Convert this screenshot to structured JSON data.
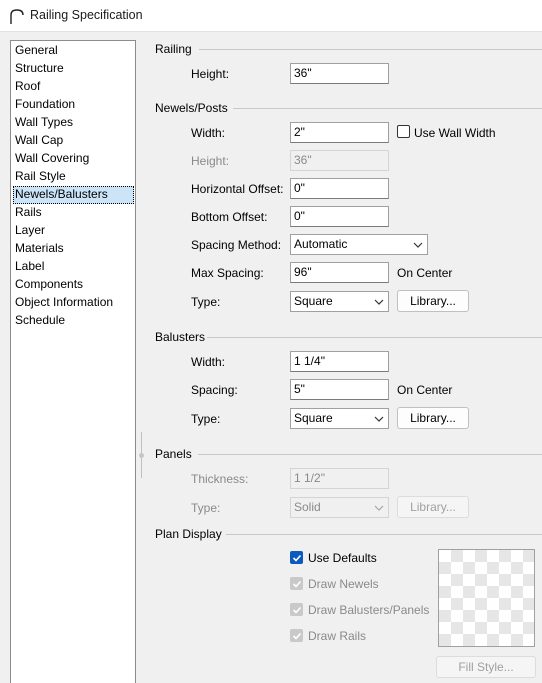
{
  "window": {
    "title": "Railing Specification"
  },
  "nav": {
    "items": [
      "General",
      "Structure",
      "Roof",
      "Foundation",
      "Wall Types",
      "Wall Cap",
      "Wall Covering",
      "Rail Style",
      "Newels/Balusters",
      "Rails",
      "Layer",
      "Materials",
      "Label",
      "Components",
      "Object Information",
      "Schedule"
    ],
    "selected": "Newels/Balusters"
  },
  "railing": {
    "title": "Railing",
    "height_label": "Height:",
    "height_value": "36\""
  },
  "newels": {
    "title": "Newels/Posts",
    "width_label": "Width:",
    "width_value": "2\"",
    "use_wall_width_label": "Use Wall Width",
    "use_wall_width_checked": false,
    "height_label": "Height:",
    "height_value": "36\"",
    "h_offset_label": "Horizontal Offset:",
    "h_offset_value": "0\"",
    "b_offset_label": "Bottom Offset:",
    "b_offset_value": "0\"",
    "spacing_method_label": "Spacing Method:",
    "spacing_method_value": "Automatic",
    "max_spacing_label": "Max Spacing:",
    "max_spacing_value": "96\"",
    "max_spacing_unit": "On Center",
    "type_label": "Type:",
    "type_value": "Square",
    "library_label": "Library..."
  },
  "balusters": {
    "title": "Balusters",
    "width_label": "Width:",
    "width_value": "1 1/4\"",
    "spacing_label": "Spacing:",
    "spacing_value": "5\"",
    "spacing_unit": "On Center",
    "type_label": "Type:",
    "type_value": "Square",
    "library_label": "Library..."
  },
  "panels": {
    "title": "Panels",
    "thickness_label": "Thickness:",
    "thickness_value": "1 1/2\"",
    "type_label": "Type:",
    "type_value": "Solid",
    "library_label": "Library..."
  },
  "plan_display": {
    "title": "Plan Display",
    "use_defaults_label": "Use Defaults",
    "use_defaults_checked": true,
    "draw_newels_label": "Draw Newels",
    "draw_balusters_label": "Draw Balusters/Panels",
    "draw_rails_label": "Draw Rails",
    "fill_style_label": "Fill Style..."
  },
  "colors": {
    "accent": "#0a5bbd",
    "selection": "#cce4f7"
  }
}
